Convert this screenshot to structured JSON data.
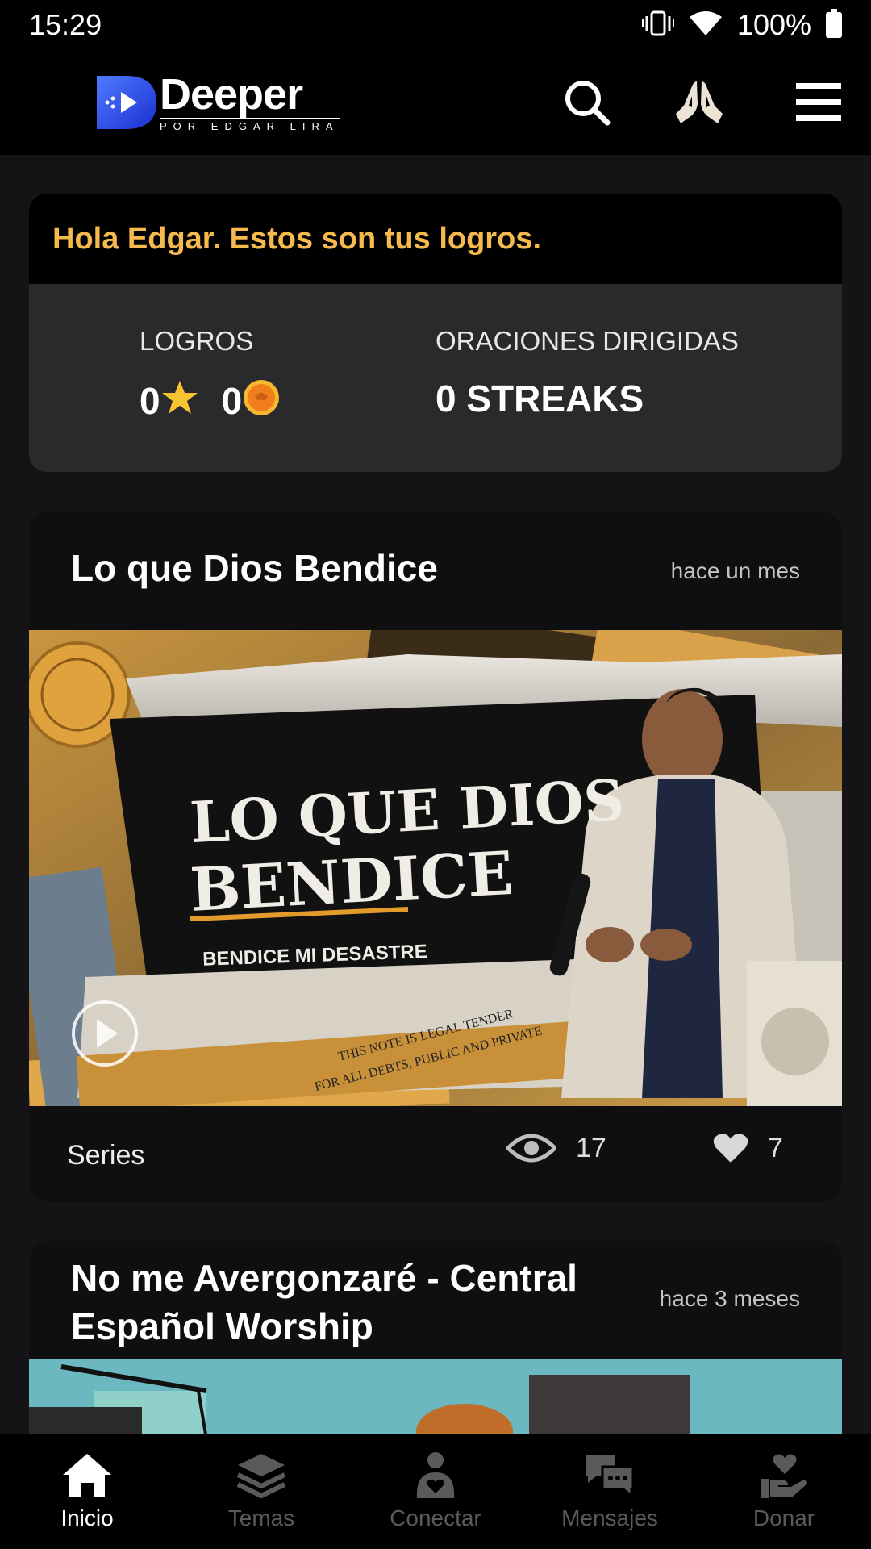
{
  "status_bar": {
    "time": "15:29",
    "battery": "100%",
    "icons": [
      "vibrate-icon",
      "wifi-icon",
      "battery-icon"
    ]
  },
  "app_bar": {
    "logo_word": "Deeper",
    "logo_sub": "POR EDGAR LIRA",
    "actions": [
      "search-icon",
      "praying-hands-icon",
      "menu-icon"
    ]
  },
  "achievements": {
    "greeting": "Hola Edgar. Estos son tus logros.",
    "logros_label": "LOGROS",
    "stars_count": "0",
    "coins_count": "0",
    "oraciones_label": "ORACIONES DIRIGIDAS",
    "streaks": "0 STREAKS"
  },
  "posts": [
    {
      "title": "Lo que Dios Bendice",
      "time": "hace un mes",
      "image": {
        "title_line1": "LO QUE DIOS",
        "title_line2": "BENDICE",
        "subtitle": "BENDICE MI DESASTRE",
        "note_line1": "THIS NOTE IS LEGAL TENDER",
        "note_line2": "FOR ALL DEBTS, PUBLIC AND PRIVATE"
      },
      "category": "Series",
      "views": "17",
      "likes": "7"
    },
    {
      "title_line1": "No me Avergonzaré - Central",
      "title_line2": "Español Worship",
      "time": "hace 3 meses"
    }
  ],
  "bottom_nav": [
    {
      "label": "Inicio",
      "icon": "home-icon",
      "active": true
    },
    {
      "label": "Temas",
      "icon": "layers-icon",
      "active": false
    },
    {
      "label": "Conectar",
      "icon": "connect-icon",
      "active": false
    },
    {
      "label": "Mensajes",
      "icon": "messages-icon",
      "active": false
    },
    {
      "label": "Donar",
      "icon": "donate-icon",
      "active": false
    }
  ],
  "colors": {
    "accent_gold": "#f5b94e",
    "background": "#141416",
    "card": "#2a2a2c",
    "logo_blue": "#2b4bff"
  }
}
